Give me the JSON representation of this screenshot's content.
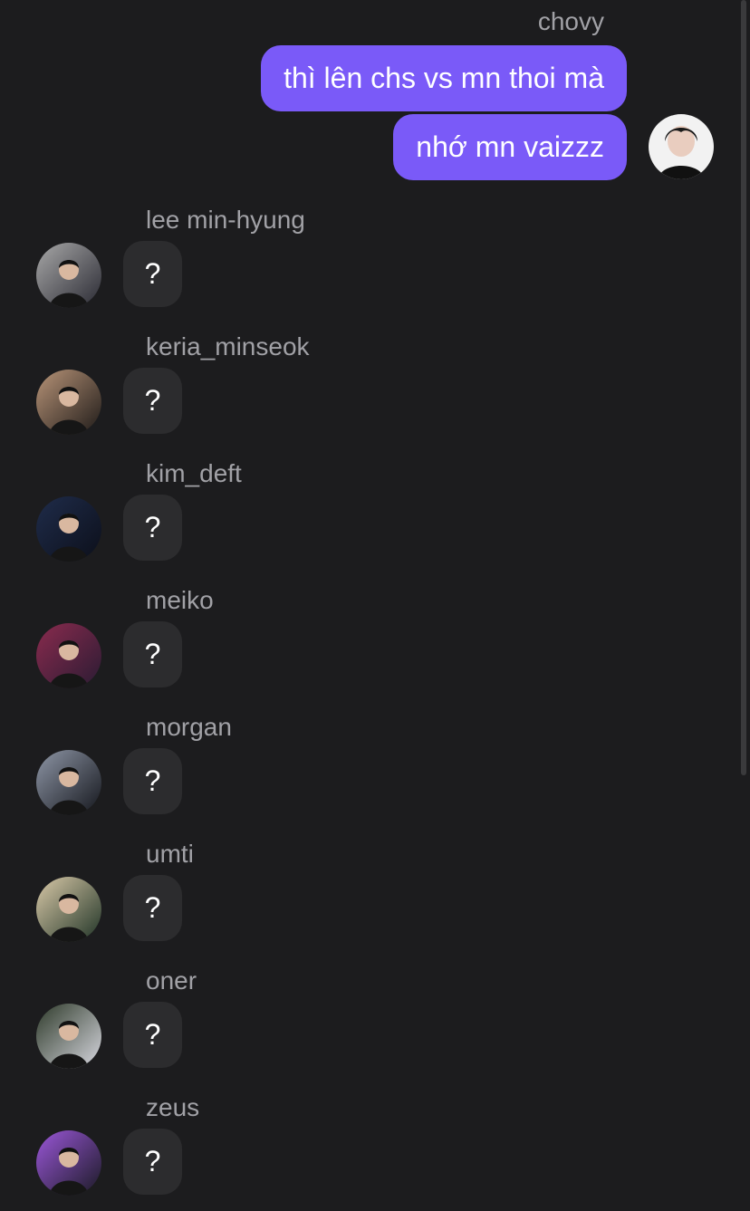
{
  "outgoing": {
    "sender": "chovy",
    "messages": [
      "thì lên chs vs mn thoi mà",
      "nhớ mn vaizzz"
    ],
    "avatar_icon": "profile-photo-icon"
  },
  "incoming": [
    {
      "name": "lee min-hyung",
      "text": "?",
      "avatar_colors": [
        "#a8a8a8",
        "#2a2a33"
      ]
    },
    {
      "name": "keria_minseok",
      "text": "?",
      "avatar_colors": [
        "#b89478",
        "#1e1a18"
      ]
    },
    {
      "name": "kim_deft",
      "text": "?",
      "avatar_colors": [
        "#1f2c4a",
        "#0c0f1a"
      ]
    },
    {
      "name": "meiko",
      "text": "?",
      "avatar_colors": [
        "#8a2b4e",
        "#2a1b33"
      ]
    },
    {
      "name": "morgan",
      "text": "?",
      "avatar_colors": [
        "#8e96a6",
        "#14161c"
      ]
    },
    {
      "name": "umti",
      "text": "?",
      "avatar_colors": [
        "#d9c9a8",
        "#1f3326"
      ]
    },
    {
      "name": "oner",
      "text": "?",
      "avatar_colors": [
        "#2e3a2a",
        "#d8d8e0"
      ]
    },
    {
      "name": "zeus",
      "text": "?",
      "avatar_colors": [
        "#9b57d9",
        "#1a1a24"
      ]
    }
  ],
  "theme": {
    "background": "#1c1c1e",
    "outgoing_bubble": "#7a5af8",
    "incoming_bubble": "#2c2c2e",
    "name_text": "#a1a1a6"
  }
}
